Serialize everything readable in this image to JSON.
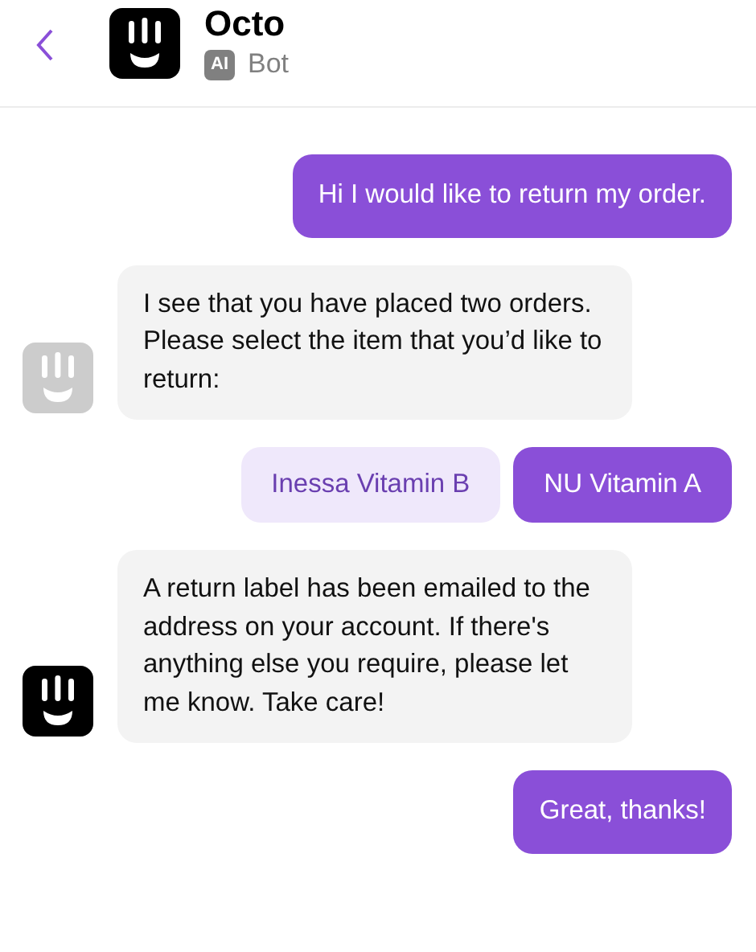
{
  "header": {
    "title": "Octo",
    "badge": "AI",
    "subtitle": "Bot"
  },
  "messages": [
    {
      "kind": "user",
      "text": "Hi I would like to return my order."
    },
    {
      "kind": "bot",
      "avatar_faded": true,
      "text": "I see that you have placed two orders. Please select the item that you’d like to return:"
    },
    {
      "kind": "choices",
      "options": [
        {
          "label": "Inessa Vitamin B",
          "selected": false
        },
        {
          "label": "NU Vitamin A",
          "selected": true
        }
      ]
    },
    {
      "kind": "bot",
      "avatar_faded": false,
      "text": "A return label has been emailed to the address on your account. If there's anything else you require, please let me know. Take care!"
    },
    {
      "kind": "user",
      "text": "Great, thanks!"
    }
  ]
}
